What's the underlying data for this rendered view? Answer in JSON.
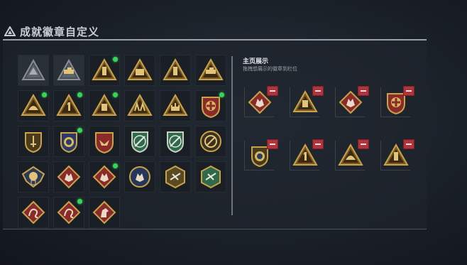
{
  "header": {
    "title": "成就徽章自定义"
  },
  "right_panel": {
    "title": "主页展示",
    "subtitle": "拖拽想展示的徽章到栏位"
  },
  "colors": {
    "gold": "#c9a24a",
    "dark_gold": "#7a5b22",
    "red": "#8b2a2a",
    "green": "#2f6a4a",
    "new_dot": "#37d35a",
    "remove": "#b3333c"
  },
  "badges": [
    {
      "shape": "tri-gray",
      "icon": "hill-icon",
      "new": false,
      "selected": true
    },
    {
      "shape": "tri-gray",
      "icon": "tank-icon",
      "new": false,
      "selected": true
    },
    {
      "shape": "tri",
      "icon": "tower-icon",
      "new": true,
      "selected": false
    },
    {
      "shape": "tri",
      "icon": "fortress-icon",
      "new": false,
      "selected": false
    },
    {
      "shape": "tri",
      "icon": "tower-icon",
      "new": false,
      "selected": false
    },
    {
      "shape": "tri",
      "icon": "tank-icon",
      "new": false,
      "selected": false
    },
    {
      "shape": "tri",
      "icon": "helmet-icon",
      "new": true,
      "selected": false
    },
    {
      "shape": "tri",
      "icon": "number-one-icon",
      "new": true,
      "selected": false
    },
    {
      "shape": "tri",
      "icon": "block-icon",
      "new": true,
      "selected": false
    },
    {
      "shape": "tri",
      "icon": "soldiers-icon",
      "new": false,
      "selected": false
    },
    {
      "shape": "tri",
      "icon": "castle-icon",
      "new": false,
      "selected": false
    },
    {
      "shape": "shield-red",
      "icon": "cross-icon",
      "new": true,
      "selected": false
    },
    {
      "shape": "shield-gold",
      "icon": "sword-icon",
      "new": false,
      "selected": false
    },
    {
      "shape": "shield-blue",
      "icon": "sun-icon",
      "new": true,
      "selected": false
    },
    {
      "shape": "shield-red",
      "icon": "eagle-icon",
      "new": false,
      "selected": false
    },
    {
      "shape": "shield-green",
      "icon": "rifle-icon",
      "new": false,
      "selected": false
    },
    {
      "shape": "shield-green",
      "icon": "rifle-icon",
      "new": false,
      "selected": false
    },
    {
      "shape": "circle",
      "icon": "no-rifle-icon",
      "new": false,
      "selected": false
    },
    {
      "shape": "winged",
      "icon": "medal-icon",
      "new": false,
      "selected": false
    },
    {
      "shape": "diamond",
      "icon": "wolf-icon",
      "new": false,
      "selected": false
    },
    {
      "shape": "diamond",
      "icon": "wolf-icon",
      "new": true,
      "selected": false
    },
    {
      "shape": "circle-blue",
      "icon": "wolf-icon",
      "new": false,
      "selected": false
    },
    {
      "shape": "hex-gold",
      "icon": "plane-icon",
      "new": false,
      "selected": false
    },
    {
      "shape": "hex-green",
      "icon": "plane-icon",
      "new": false,
      "selected": false
    },
    {
      "shape": "diamond",
      "icon": "dragon-icon",
      "new": false,
      "selected": false
    },
    {
      "shape": "diamond",
      "icon": "dragon-icon",
      "new": true,
      "selected": false
    },
    {
      "shape": "diamond",
      "icon": "horse-icon",
      "new": false,
      "selected": false
    }
  ],
  "slots": [
    {
      "shape": "diamond",
      "icon": "wolf-icon"
    },
    {
      "shape": "tri",
      "icon": "block-icon"
    },
    {
      "shape": "diamond",
      "icon": "wolf-icon"
    },
    {
      "shape": "shield-red",
      "icon": "cross-icon"
    },
    {
      "shape": "shield-gold",
      "icon": "sun-icon"
    },
    {
      "shape": "tri",
      "icon": "number-one-icon"
    },
    {
      "shape": "tri",
      "icon": "helmet-icon"
    },
    {
      "shape": "tri",
      "icon": "tower-icon"
    }
  ]
}
